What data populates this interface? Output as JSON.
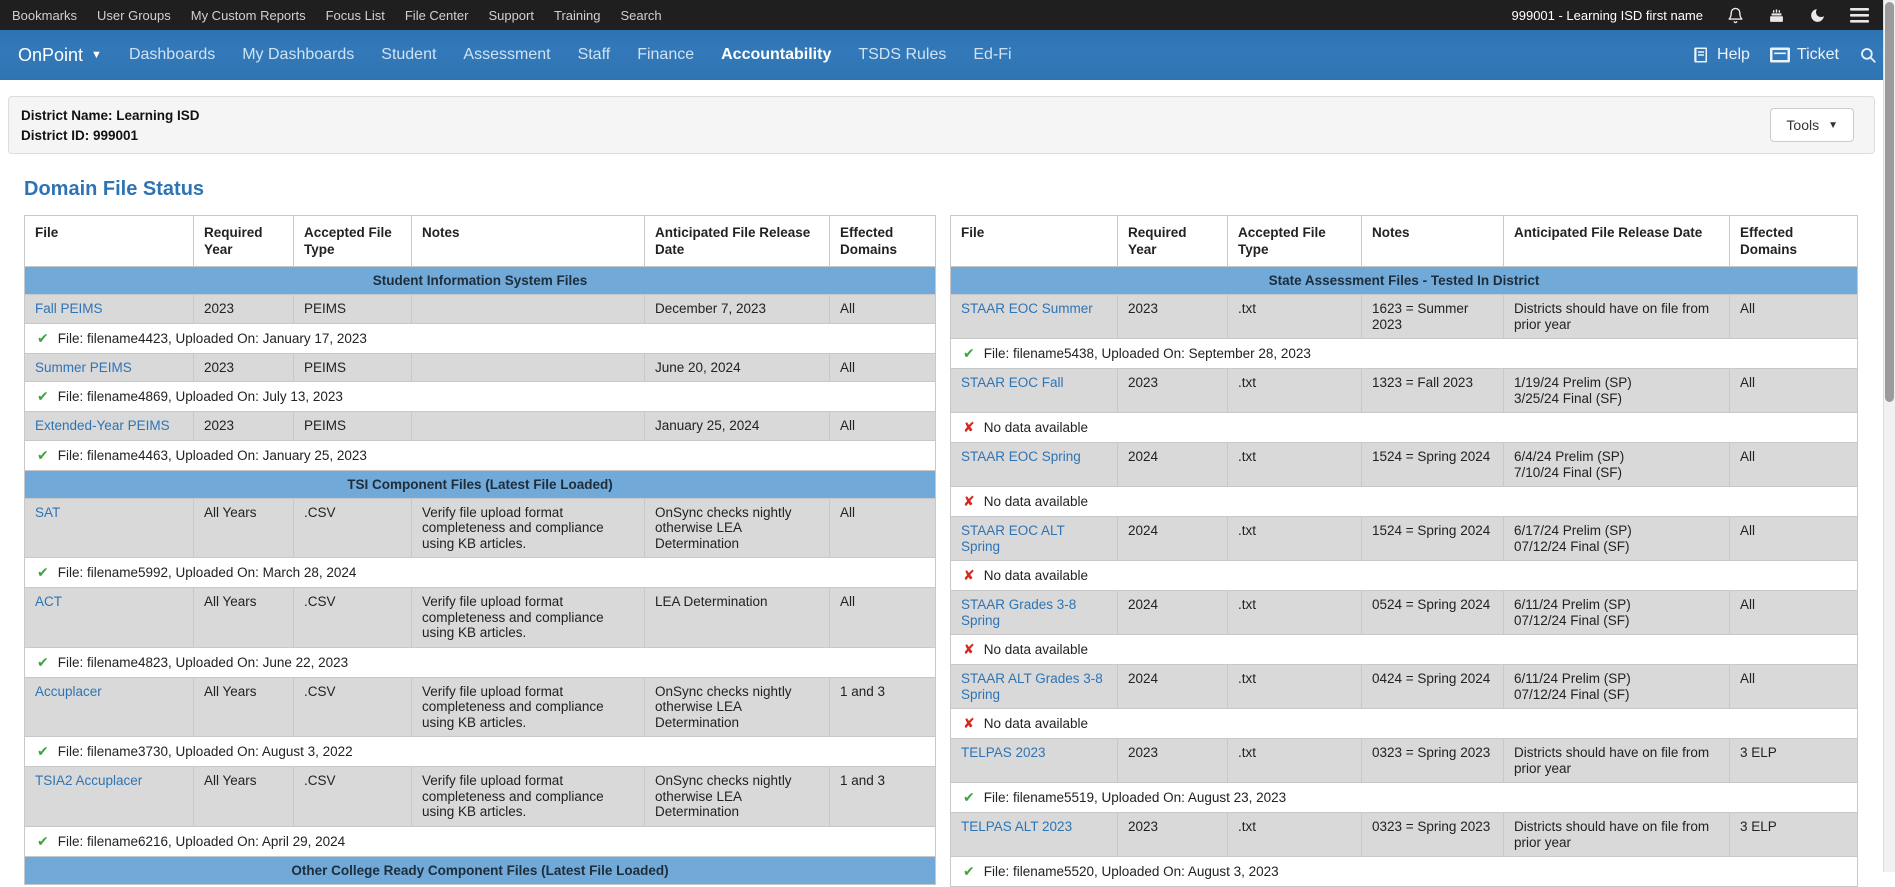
{
  "theme": {
    "topbar_dark": "#1f1f1f",
    "navbar_blue": "#3177b6",
    "section_blue": "#71a9d9",
    "link_blue": "#2e74b4",
    "title_blue": "#2e74b4",
    "row_gray": "#d9d9d9",
    "ok_green": "#3fa33f",
    "error_red": "#d42a20"
  },
  "topbar": {
    "menu": [
      "Bookmarks",
      "User Groups",
      "My Custom Reports",
      "Focus List",
      "File Center",
      "Support",
      "Training",
      "Search"
    ],
    "account": "999001 - Learning ISD first name",
    "icons": [
      "bell-icon",
      "cake-icon",
      "moon-icon",
      "menu-icon"
    ]
  },
  "navbar": {
    "brand": "OnPoint",
    "items": [
      {
        "label": "Dashboards",
        "active": false
      },
      {
        "label": "My Dashboards",
        "active": false
      },
      {
        "label": "Student",
        "active": false
      },
      {
        "label": "Assessment",
        "active": false
      },
      {
        "label": "Staff",
        "active": false
      },
      {
        "label": "Finance",
        "active": false
      },
      {
        "label": "Accountability",
        "active": true
      },
      {
        "label": "TSDS Rules",
        "active": false
      },
      {
        "label": "Ed-Fi",
        "active": false
      }
    ],
    "help_label": "Help",
    "ticket_label": "Ticket"
  },
  "district": {
    "name_line": "District Name: Learning ISD",
    "id_line": "District ID: 999001",
    "tools_label": "Tools"
  },
  "page_title": "Domain File Status",
  "tables": [
    {
      "name": "left",
      "columns": [
        "File",
        "Required Year",
        "Accepted File Type",
        "Notes",
        "Anticipated File Release Date",
        "Effected Domains"
      ],
      "rows": [
        {
          "type": "section",
          "label": "Student Information System Files"
        },
        {
          "type": "file",
          "file": "Fall PEIMS",
          "year": "2023",
          "file_type": "PEIMS",
          "notes": "",
          "release": "December 7, 2023",
          "domains": "All"
        },
        {
          "type": "status",
          "ok": true,
          "text": "File: filename4423, Uploaded On: January 17, 2023"
        },
        {
          "type": "file",
          "file": "Summer PEIMS",
          "year": "2023",
          "file_type": "PEIMS",
          "notes": "",
          "release": "June 20, 2024",
          "domains": "All"
        },
        {
          "type": "status",
          "ok": true,
          "text": "File: filename4869, Uploaded On: July 13, 2023"
        },
        {
          "type": "file",
          "file": "Extended-Year PEIMS",
          "year": "2023",
          "file_type": "PEIMS",
          "notes": "",
          "release": "January 25, 2024",
          "domains": "All"
        },
        {
          "type": "status",
          "ok": true,
          "text": "File: filename4463, Uploaded On: January 25, 2023"
        },
        {
          "type": "section",
          "label": "TSI Component Files (Latest File Loaded)"
        },
        {
          "type": "file",
          "file": "SAT",
          "year": "All Years",
          "file_type": ".CSV",
          "notes": "Verify file upload format completeness and compliance using KB articles.",
          "release": "OnSync checks nightly otherwise LEA Determination",
          "domains": "All"
        },
        {
          "type": "status",
          "ok": true,
          "text": "File: filename5992, Uploaded On: March 28, 2024"
        },
        {
          "type": "file",
          "file": "ACT",
          "year": "All Years",
          "file_type": ".CSV",
          "notes": "Verify file upload format completeness and compliance using KB articles.",
          "release": "LEA Determination",
          "domains": "All"
        },
        {
          "type": "status",
          "ok": true,
          "text": "File: filename4823, Uploaded On: June 22, 2023"
        },
        {
          "type": "file",
          "file": "Accuplacer",
          "year": "All Years",
          "file_type": ".CSV",
          "notes": "Verify file upload format completeness and compliance using KB articles.",
          "release": "OnSync checks nightly otherwise LEA Determination",
          "domains": "1 and 3"
        },
        {
          "type": "status",
          "ok": true,
          "text": "File: filename3730, Uploaded On: August 3, 2022"
        },
        {
          "type": "file",
          "file": "TSIA2 Accuplacer",
          "year": "All Years",
          "file_type": ".CSV",
          "notes": "Verify file upload format completeness and compliance using KB articles.",
          "release": "OnSync checks nightly otherwise LEA Determination",
          "domains": "1 and 3"
        },
        {
          "type": "status",
          "ok": true,
          "text": "File: filename6216, Uploaded On: April 29, 2024"
        },
        {
          "type": "section",
          "label": "Other College Ready Component Files (Latest File Loaded)"
        }
      ]
    },
    {
      "name": "right",
      "columns": [
        "File",
        "Required Year",
        "Accepted File Type",
        "Notes",
        "Anticipated File Release Date",
        "Effected Domains"
      ],
      "rows": [
        {
          "type": "section",
          "label": "State Assessment Files - Tested In District"
        },
        {
          "type": "file",
          "file": "STAAR EOC Summer",
          "year": "2023",
          "file_type": ".txt",
          "notes": "1623 = Summer 2023",
          "release": "Districts should have on file from prior year",
          "domains": "All"
        },
        {
          "type": "status",
          "ok": true,
          "text": "File: filename5438, Uploaded On: September 28, 2023"
        },
        {
          "type": "file",
          "file": "STAAR EOC Fall",
          "year": "2023",
          "file_type": ".txt",
          "notes": "1323 = Fall 2023",
          "release": "1/19/24 Prelim (SP)\n3/25/24 Final (SF)",
          "domains": "All"
        },
        {
          "type": "status",
          "ok": false,
          "text": "No data available"
        },
        {
          "type": "file",
          "file": "STAAR EOC Spring",
          "year": "2024",
          "file_type": ".txt",
          "notes": "1524 = Spring 2024",
          "release": "6/4/24 Prelim (SP)\n7/10/24 Final (SF)",
          "domains": "All"
        },
        {
          "type": "status",
          "ok": false,
          "text": "No data available"
        },
        {
          "type": "file",
          "file": "STAAR EOC ALT Spring",
          "year": "2024",
          "file_type": ".txt",
          "notes": "1524 = Spring 2024",
          "release": "6/17/24 Prelim (SP)\n07/12/24 Final (SF)",
          "domains": "All"
        },
        {
          "type": "status",
          "ok": false,
          "text": "No data available"
        },
        {
          "type": "file",
          "file": "STAAR Grades 3-8 Spring",
          "year": "2024",
          "file_type": ".txt",
          "notes": "0524 = Spring 2024",
          "release": "6/11/24 Prelim (SP)\n07/12/24 Final (SF)",
          "domains": "All"
        },
        {
          "type": "status",
          "ok": false,
          "text": "No data available"
        },
        {
          "type": "file",
          "file": "STAAR ALT Grades 3-8 Spring",
          "year": "2024",
          "file_type": ".txt",
          "notes": "0424 = Spring 2024",
          "release": "6/11/24 Prelim (SP)\n07/12/24 Final (SF)",
          "domains": "All"
        },
        {
          "type": "status",
          "ok": false,
          "text": "No data available"
        },
        {
          "type": "file",
          "file": "TELPAS 2023",
          "year": "2023",
          "file_type": ".txt",
          "notes": "0323 = Spring 2023",
          "release": "Districts should have on file from prior year",
          "domains": "3 ELP"
        },
        {
          "type": "status",
          "ok": true,
          "text": "File: filename5519, Uploaded On: August 23, 2023"
        },
        {
          "type": "file",
          "file": "TELPAS ALT 2023",
          "year": "2023",
          "file_type": ".txt",
          "notes": "0323 = Spring 2023",
          "release": "Districts should have on file from prior year",
          "domains": "3 ELP"
        },
        {
          "type": "status",
          "ok": true,
          "text": "File: filename5520, Uploaded On: August 3, 2023"
        }
      ]
    }
  ]
}
